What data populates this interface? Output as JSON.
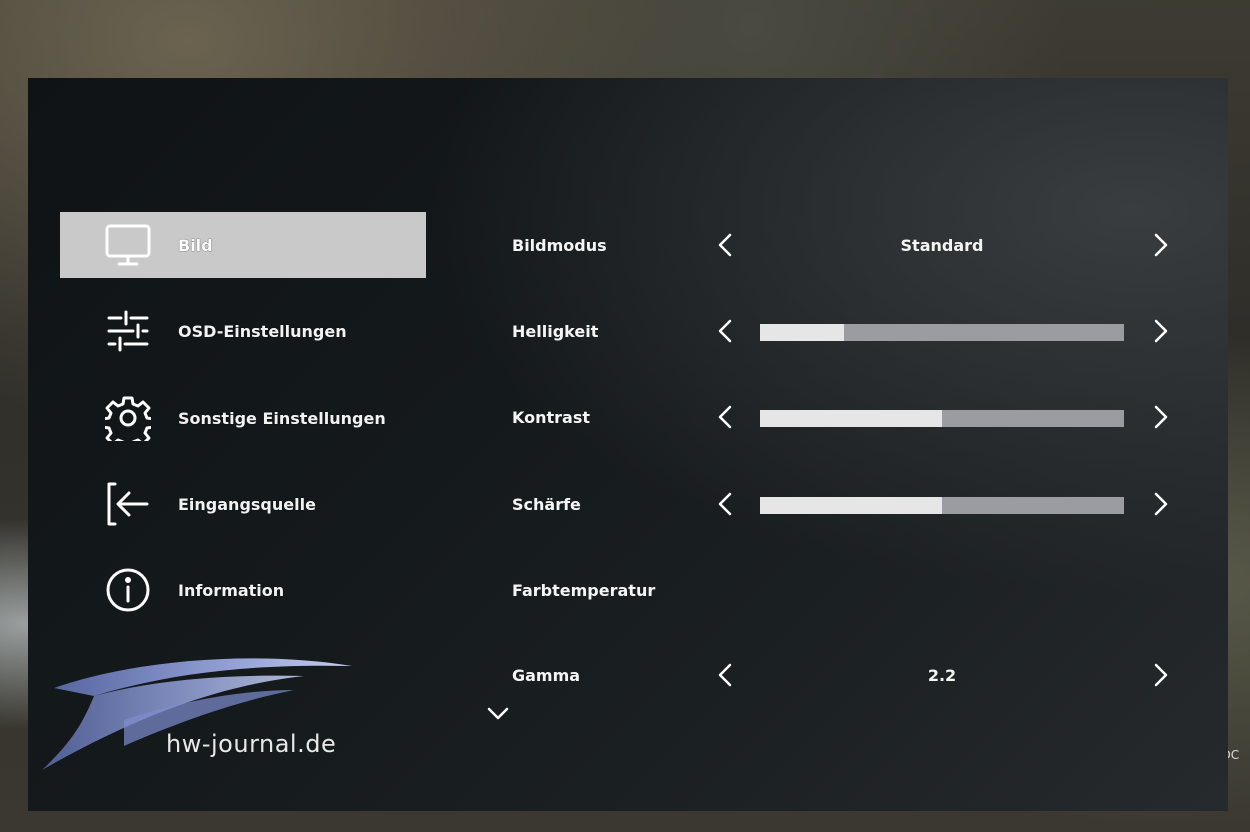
{
  "menu": {
    "items": [
      {
        "label": "Bild",
        "icon": "monitor-icon",
        "active": true
      },
      {
        "label": "OSD-Einstellungen",
        "icon": "sliders-icon",
        "active": false
      },
      {
        "label": "Sonstige Einstellungen",
        "icon": "gear-icon",
        "active": false
      },
      {
        "label": "Eingangsquelle",
        "icon": "input-source-icon",
        "active": false
      },
      {
        "label": "Information",
        "icon": "info-icon",
        "active": false
      }
    ]
  },
  "settings": {
    "bildmodus": {
      "label": "Bildmodus",
      "value": "Standard"
    },
    "helligkeit": {
      "label": "Helligkeit",
      "level": 0.23
    },
    "kontrast": {
      "label": "Kontrast",
      "level": 0.5
    },
    "schaerfe": {
      "label": "Schärfe",
      "level": 0.5
    },
    "farbtemperatur": {
      "label": "Farbtemperatur"
    },
    "gamma": {
      "label": "Gamma",
      "value": "2.2"
    }
  },
  "watermark": {
    "text": "hw-journal.de"
  },
  "background_text": "t DC",
  "colors": {
    "active_bg": "#c9c9c9",
    "bar_fill": "#e6e6e6",
    "bar_track": "#9a9ca2",
    "panel_bg": "#14191b"
  }
}
